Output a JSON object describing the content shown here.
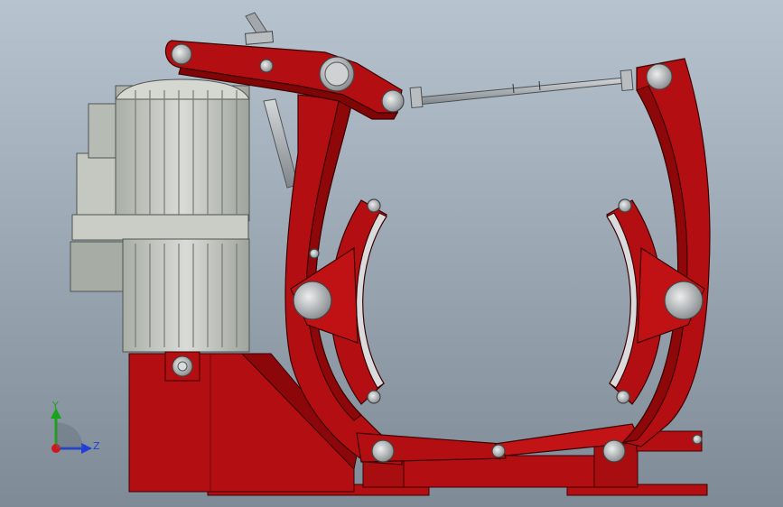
{
  "viewport": {
    "background_top": "#b7c3cf",
    "background_bottom": "#7e8b97"
  },
  "colors": {
    "frame_red": "#b30f12",
    "frame_red_dark": "#7a0608",
    "frame_red_light": "#d5383a",
    "motor_gray": "#c7cbc4",
    "motor_dark": "#6f746f",
    "pin_gray": "#b8bbbd",
    "rod_gray": "#9aa0a5"
  },
  "triad": {
    "y_label": "Y",
    "z_label": "Z",
    "y_color": "#1aa31a",
    "z_color": "#1f3fd6",
    "x_color": "#d01818"
  }
}
